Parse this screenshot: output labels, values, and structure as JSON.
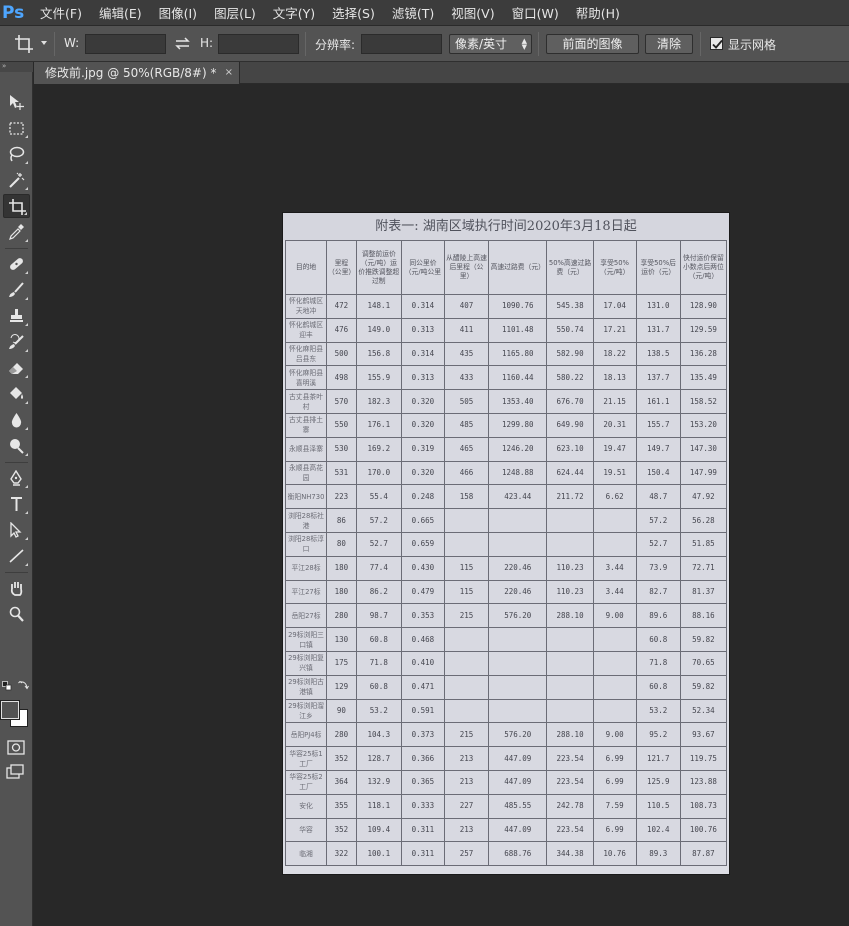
{
  "app": {
    "logo": "Ps"
  },
  "menu": [
    "文件(F)",
    "编辑(E)",
    "图像(I)",
    "图层(L)",
    "文字(Y)",
    "选择(S)",
    "滤镜(T)",
    "视图(V)",
    "窗口(W)",
    "帮助(H)"
  ],
  "options": {
    "tool_icon": "crop-icon",
    "width_label": "W:",
    "width_value": "",
    "swap_icon": "swap-arrows-icon",
    "height_label": "H:",
    "height_value": "",
    "resolution_label": "分辨率:",
    "resolution_value": "",
    "unit_value": "像素/英寸",
    "front_image_label": "前面的图像",
    "clear_label": "清除",
    "show_grid_label": "显示网格",
    "show_grid_checked": true
  },
  "tab": {
    "title": "修改前.jpg @ 50%(RGB/8#) *",
    "close": "×"
  },
  "tools": [
    "move-icon",
    "rect-marquee-icon",
    "lasso-icon",
    "magic-wand-icon",
    "crop-icon",
    "eyedropper-icon",
    "healing-brush-icon",
    "brush-icon",
    "clone-stamp-icon",
    "history-brush-icon",
    "eraser-icon",
    "paint-bucket-icon",
    "blur-icon",
    "dodge-icon",
    "pen-icon",
    "type-icon",
    "path-selection-icon",
    "line-icon",
    "hand-icon",
    "zoom-icon"
  ],
  "colors": {
    "foreground": "#535353",
    "background": "#ffffff",
    "app_accent": "#4ea6ff"
  },
  "document": {
    "title": "附表一: 湖南区域执行时间2020年3月18日起",
    "headers": [
      "目的地",
      "里程（公里）",
      "调整前运价（元/吨）运价推跌调整超过制",
      "同公里价（元/吨公里",
      "从醴陵上高速后里程（公里）",
      "高速过路费（元）",
      "50%高速过路费（元）",
      "享受50%（元/吨）",
      "享受50%后运价（元）",
      "快付运价保留小数点后两位（元/吨）"
    ],
    "rows": [
      [
        "怀化鹤城区天地冲",
        "472",
        "148.1",
        "0.314",
        "407",
        "1090.76",
        "545.38",
        "17.04",
        "131.0",
        "128.90"
      ],
      [
        "怀化鹤城区迎丰",
        "476",
        "149.0",
        "0.313",
        "411",
        "1101.48",
        "550.74",
        "17.21",
        "131.7",
        "129.59"
      ],
      [
        "怀化麻阳县吕县东",
        "500",
        "156.8",
        "0.314",
        "435",
        "1165.80",
        "582.90",
        "18.22",
        "138.5",
        "136.28"
      ],
      [
        "怀化麻阳县喜明溪",
        "498",
        "155.9",
        "0.313",
        "433",
        "1160.44",
        "580.22",
        "18.13",
        "137.7",
        "135.49"
      ],
      [
        "古丈县茶叶村",
        "570",
        "182.3",
        "0.320",
        "505",
        "1353.40",
        "676.70",
        "21.15",
        "161.1",
        "158.52"
      ],
      [
        "古丈县排土寨",
        "550",
        "176.1",
        "0.320",
        "485",
        "1299.80",
        "649.90",
        "20.31",
        "155.7",
        "153.20"
      ],
      [
        "永顺县泽寨",
        "530",
        "169.2",
        "0.319",
        "465",
        "1246.20",
        "623.10",
        "19.47",
        "149.7",
        "147.30"
      ],
      [
        "永顺县高花园",
        "531",
        "170.0",
        "0.320",
        "466",
        "1248.88",
        "624.44",
        "19.51",
        "150.4",
        "147.99"
      ],
      [
        "衡阳NH730",
        "223",
        "55.4",
        "0.248",
        "158",
        "423.44",
        "211.72",
        "6.62",
        "48.7",
        "47.92"
      ],
      [
        "浏阳28标社港",
        "86",
        "57.2",
        "0.665",
        "",
        "",
        "",
        "",
        "57.2",
        "56.28"
      ],
      [
        "浏阳28标淳口",
        "80",
        "52.7",
        "0.659",
        "",
        "",
        "",
        "",
        "52.7",
        "51.85"
      ],
      [
        "平江28标",
        "180",
        "77.4",
        "0.430",
        "115",
        "220.46",
        "110.23",
        "3.44",
        "73.9",
        "72.71"
      ],
      [
        "平江27标",
        "180",
        "86.2",
        "0.479",
        "115",
        "220.46",
        "110.23",
        "3.44",
        "82.7",
        "81.37"
      ],
      [
        "岳阳27标",
        "280",
        "98.7",
        "0.353",
        "215",
        "576.20",
        "288.10",
        "9.00",
        "89.6",
        "88.16"
      ],
      [
        "29标浏阳三口镇",
        "130",
        "60.8",
        "0.468",
        "",
        "",
        "",
        "",
        "60.8",
        "59.82"
      ],
      [
        "29标浏阳复兴镇",
        "175",
        "71.8",
        "0.410",
        "",
        "",
        "",
        "",
        "71.8",
        "70.65"
      ],
      [
        "29标浏阳古港镇",
        "129",
        "60.8",
        "0.471",
        "",
        "",
        "",
        "",
        "60.8",
        "59.82"
      ],
      [
        "29标浏阳溜江乡",
        "90",
        "53.2",
        "0.591",
        "",
        "",
        "",
        "",
        "53.2",
        "52.34"
      ],
      [
        "岳阳PJ4标",
        "280",
        "104.3",
        "0.373",
        "215",
        "576.20",
        "288.10",
        "9.00",
        "95.2",
        "93.67"
      ],
      [
        "华容25标1工厂",
        "352",
        "128.7",
        "0.366",
        "213",
        "447.09",
        "223.54",
        "6.99",
        "121.7",
        "119.75"
      ],
      [
        "华容25标2工厂",
        "364",
        "132.9",
        "0.365",
        "213",
        "447.09",
        "223.54",
        "6.99",
        "125.9",
        "123.88"
      ],
      [
        "安化",
        "355",
        "118.1",
        "0.333",
        "227",
        "485.55",
        "242.78",
        "7.59",
        "110.5",
        "108.73"
      ],
      [
        "华容",
        "352",
        "109.4",
        "0.311",
        "213",
        "447.09",
        "223.54",
        "6.99",
        "102.4",
        "100.76"
      ],
      [
        "临湘",
        "322",
        "100.1",
        "0.311",
        "257",
        "688.76",
        "344.38",
        "10.76",
        "89.3",
        "87.87"
      ]
    ]
  }
}
